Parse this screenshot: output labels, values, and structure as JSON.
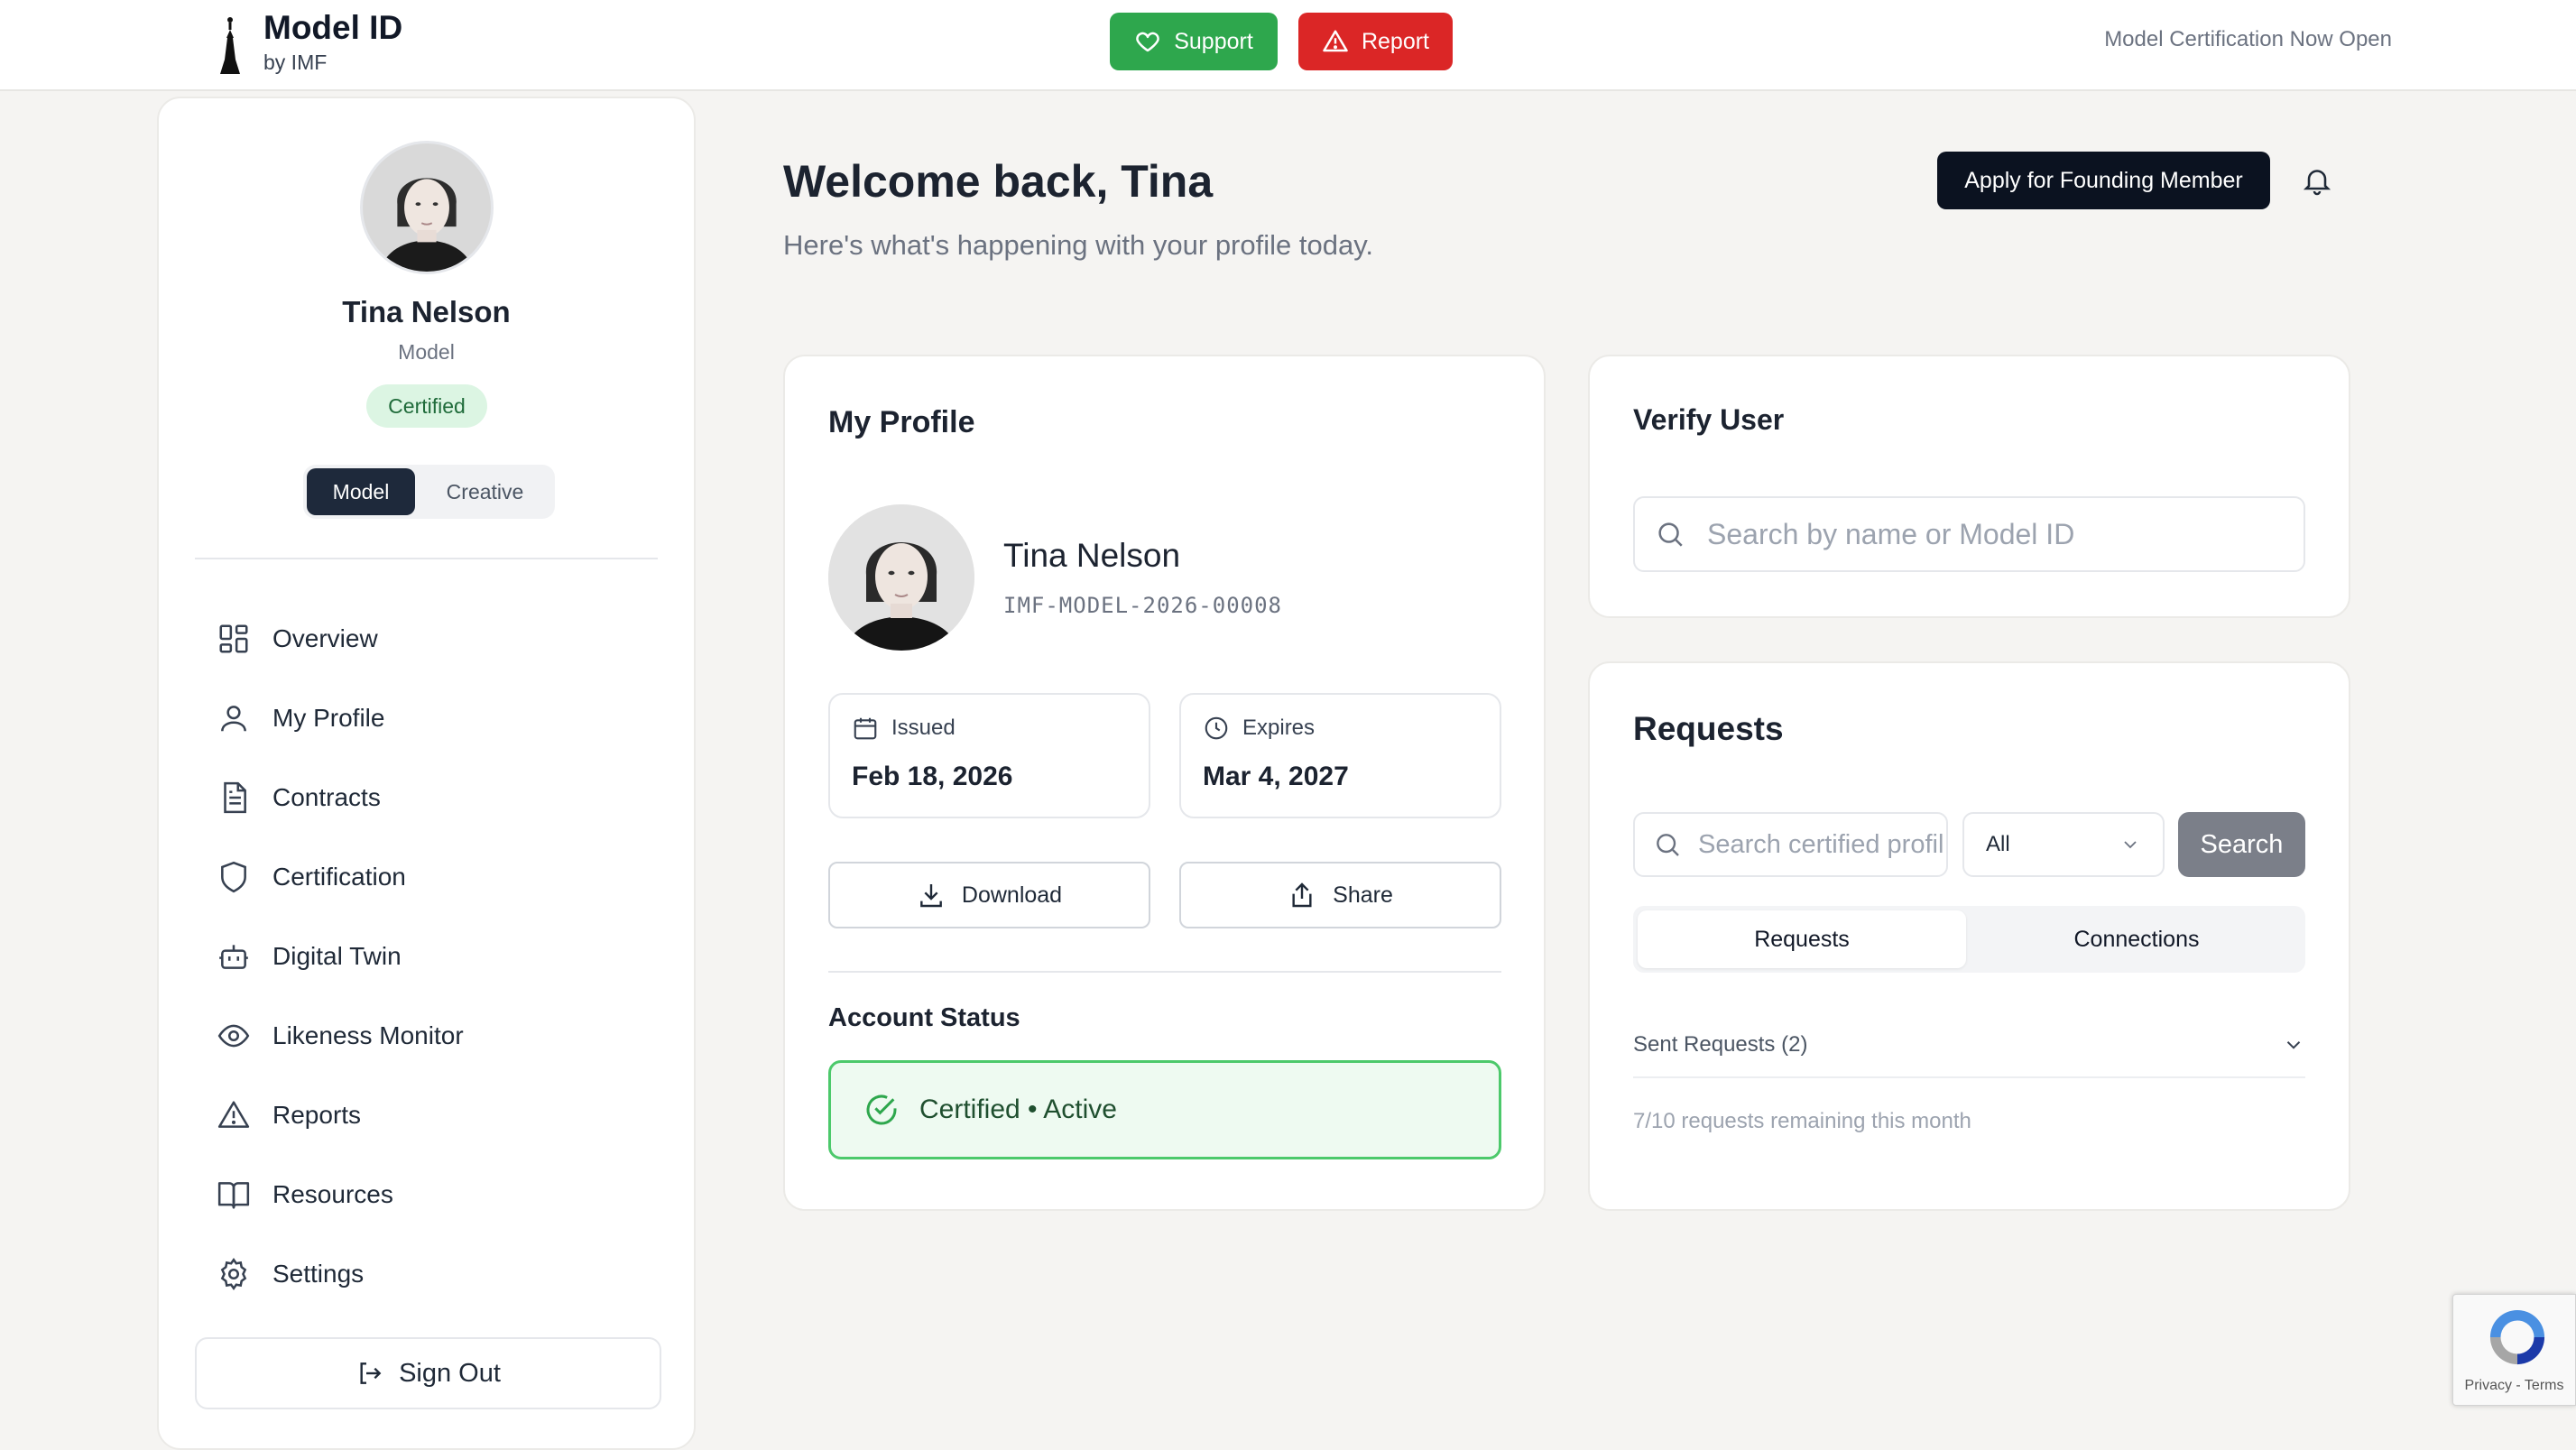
{
  "brand": {
    "name": "Model ID",
    "sub": "by IMF"
  },
  "topbar": {
    "support": "Support",
    "report": "Report",
    "notice": "Model Certification Now Open"
  },
  "sidebar": {
    "name": "Tina Nelson",
    "role": "Model",
    "badge": "Certified",
    "toggle": {
      "model": "Model",
      "creative": "Creative",
      "selected": "Model"
    },
    "items": [
      {
        "label": "Overview",
        "icon": "grid-icon"
      },
      {
        "label": "My Profile",
        "icon": "user-icon"
      },
      {
        "label": "Contracts",
        "icon": "document-icon"
      },
      {
        "label": "Certification",
        "icon": "shield-icon"
      },
      {
        "label": "Digital Twin",
        "icon": "robot-icon"
      },
      {
        "label": "Likeness Monitor",
        "icon": "eye-icon"
      },
      {
        "label": "Reports",
        "icon": "warning-icon"
      },
      {
        "label": "Resources",
        "icon": "book-icon"
      },
      {
        "label": "Settings",
        "icon": "gear-icon"
      }
    ],
    "signout": "Sign Out"
  },
  "header": {
    "welcome": "Welcome back, Tina",
    "subtitle": "Here's what's happening with your profile today.",
    "founding_button": "Apply for Founding Member"
  },
  "profile": {
    "title": "My Profile",
    "name": "Tina Nelson",
    "model_id": "IMF-MODEL-2026-00008",
    "issued_label": "Issued",
    "issued_value": "Feb 18, 2026",
    "expires_label": "Expires",
    "expires_value": "Mar 4, 2027",
    "download": "Download",
    "share": "Share",
    "status_label": "Account Status",
    "status_value": "Certified • Active"
  },
  "verify": {
    "title": "Verify User",
    "placeholder": "Search by name or Model ID"
  },
  "requests": {
    "title": "Requests",
    "search_placeholder": "Search certified profiles",
    "filter_value": "All",
    "search_button": "Search",
    "tabs": [
      "Requests",
      "Connections"
    ],
    "active_tab": "Requests",
    "sent_label": "Sent Requests (2)",
    "remaining": "7/10 requests remaining this month"
  },
  "recaptcha": {
    "text": "Privacy - Terms"
  },
  "colors": {
    "support_green": "#2ea74d",
    "report_red": "#db2626",
    "dark": "#0b1220",
    "certified_bg": "#dcf5e3",
    "status_border": "#4cc96b",
    "search_gray": "#7b7f89"
  }
}
